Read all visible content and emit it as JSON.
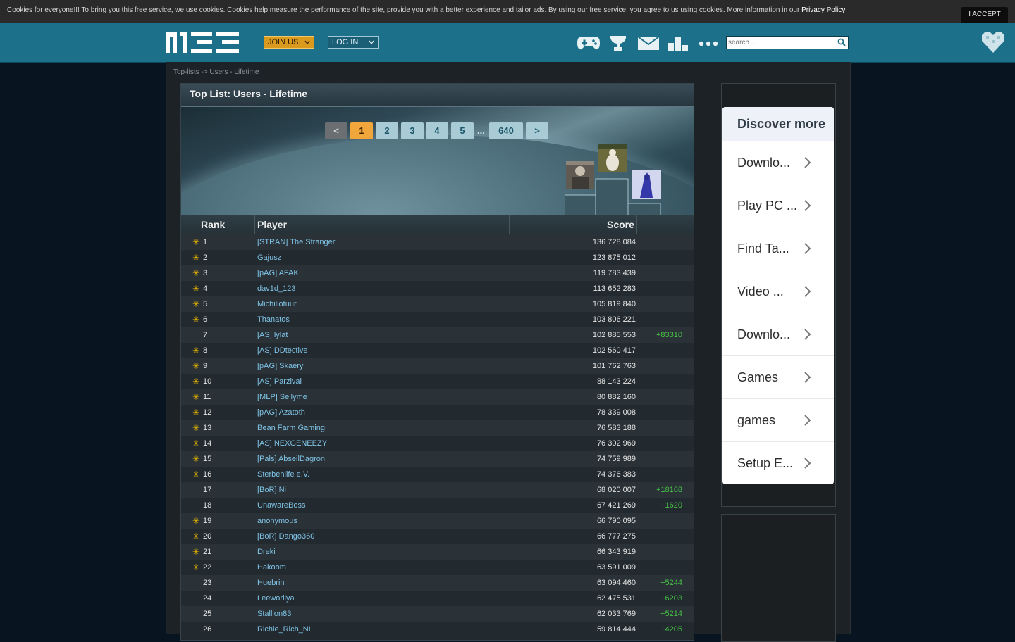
{
  "cookie": {
    "text": "Cookies for everyone!!! To bring you this free service, we use cookies. Cookies help measure the performance of the site, provide you with a better experience and tailor ads. By using our free service, you agree to us using cookies. More information in our ",
    "link": "Privacy Policy",
    "accept": "I ACCEPT"
  },
  "header": {
    "logo": "MEE",
    "join": "JOIN US",
    "login": "LOG IN",
    "search_placeholder": "search ...",
    "icons": [
      "gamepad-icon",
      "trophy-icon",
      "mail-icon",
      "chart-icon",
      "more-icon",
      "heart-icon"
    ]
  },
  "breadcrumb": "Top-lists -> Users - Lifetime",
  "panel_title": "Top List: Users - Lifetime",
  "pager": {
    "prev": "<",
    "pages": [
      "1",
      "2",
      "3",
      "4",
      "5"
    ],
    "dots": "...",
    "last": "640",
    "next": ">",
    "active": "1"
  },
  "columns": {
    "rank": "Rank",
    "player": "Player",
    "score": "Score"
  },
  "rows": [
    {
      "star": true,
      "rank": "1",
      "player": "[STRAN] The Stranger",
      "score": "136 728 084",
      "delta": ""
    },
    {
      "star": true,
      "rank": "2",
      "player": "Gajusz",
      "score": "123 875 012",
      "delta": ""
    },
    {
      "star": true,
      "rank": "3",
      "player": "[pAG] AFAK",
      "score": "119 783 439",
      "delta": ""
    },
    {
      "star": true,
      "rank": "4",
      "player": "dav1d_123",
      "score": "113 652 283",
      "delta": ""
    },
    {
      "star": true,
      "rank": "5",
      "player": "Michiliotuur",
      "score": "105 819 840",
      "delta": ""
    },
    {
      "star": true,
      "rank": "6",
      "player": "Thanatos",
      "score": "103 806 221",
      "delta": ""
    },
    {
      "star": false,
      "rank": "7",
      "player": "[AS] lylat",
      "score": "102 885 553",
      "delta": "+83310"
    },
    {
      "star": true,
      "rank": "8",
      "player": "[AS] DDtective",
      "score": "102 560 417",
      "delta": ""
    },
    {
      "star": true,
      "rank": "9",
      "player": "[pAG] Skaery",
      "score": "101 762 763",
      "delta": ""
    },
    {
      "star": true,
      "rank": "10",
      "player": "[AS] Parzival",
      "score": "88 143 224",
      "delta": ""
    },
    {
      "star": true,
      "rank": "11",
      "player": "[MLP] Sellyme",
      "score": "80 882 160",
      "delta": ""
    },
    {
      "star": true,
      "rank": "12",
      "player": "[pAG] Azatoth",
      "score": "78 339 008",
      "delta": ""
    },
    {
      "star": true,
      "rank": "13",
      "player": "Bean Farm Gaming",
      "score": "76 583 188",
      "delta": ""
    },
    {
      "star": true,
      "rank": "14",
      "player": "[AS] NEXGENEEZY",
      "score": "76 302 969",
      "delta": ""
    },
    {
      "star": true,
      "rank": "15",
      "player": "[Pals] AbseilDagron",
      "score": "74 759 989",
      "delta": ""
    },
    {
      "star": true,
      "rank": "16",
      "player": "Sterbehilfe e.V.",
      "score": "74 376 383",
      "delta": ""
    },
    {
      "star": false,
      "rank": "17",
      "player": "[BoR] Ni",
      "score": "68 020 007",
      "delta": "+18168"
    },
    {
      "star": false,
      "rank": "18",
      "player": "UnawareBoss",
      "score": "67 421 269",
      "delta": "+1620"
    },
    {
      "star": true,
      "rank": "19",
      "player": "anonymous",
      "score": "66 790 095",
      "delta": ""
    },
    {
      "star": true,
      "rank": "20",
      "player": "[BoR] Dango360",
      "score": "66 777 275",
      "delta": ""
    },
    {
      "star": true,
      "rank": "21",
      "player": "Dreki",
      "score": "66 343 919",
      "delta": ""
    },
    {
      "star": true,
      "rank": "22",
      "player": "Hakoom",
      "score": "63 591 009",
      "delta": ""
    },
    {
      "star": false,
      "rank": "23",
      "player": "Huebrin",
      "score": "63 094 460",
      "delta": "+5244"
    },
    {
      "star": false,
      "rank": "24",
      "player": "Leeworilya",
      "score": "62 475 531",
      "delta": "+6203"
    },
    {
      "star": false,
      "rank": "25",
      "player": "Stallion83",
      "score": "62 033 769",
      "delta": "+5214"
    },
    {
      "star": false,
      "rank": "26",
      "player": "Richie_Rich_NL",
      "score": "59 814 444",
      "delta": "+4205"
    }
  ],
  "discover": {
    "title": "Discover more",
    "items": [
      "Downlo...",
      "Play PC ...",
      "Find Ta...",
      "Video ...",
      "Downlo...",
      "Games",
      "games",
      "Setup E..."
    ]
  }
}
